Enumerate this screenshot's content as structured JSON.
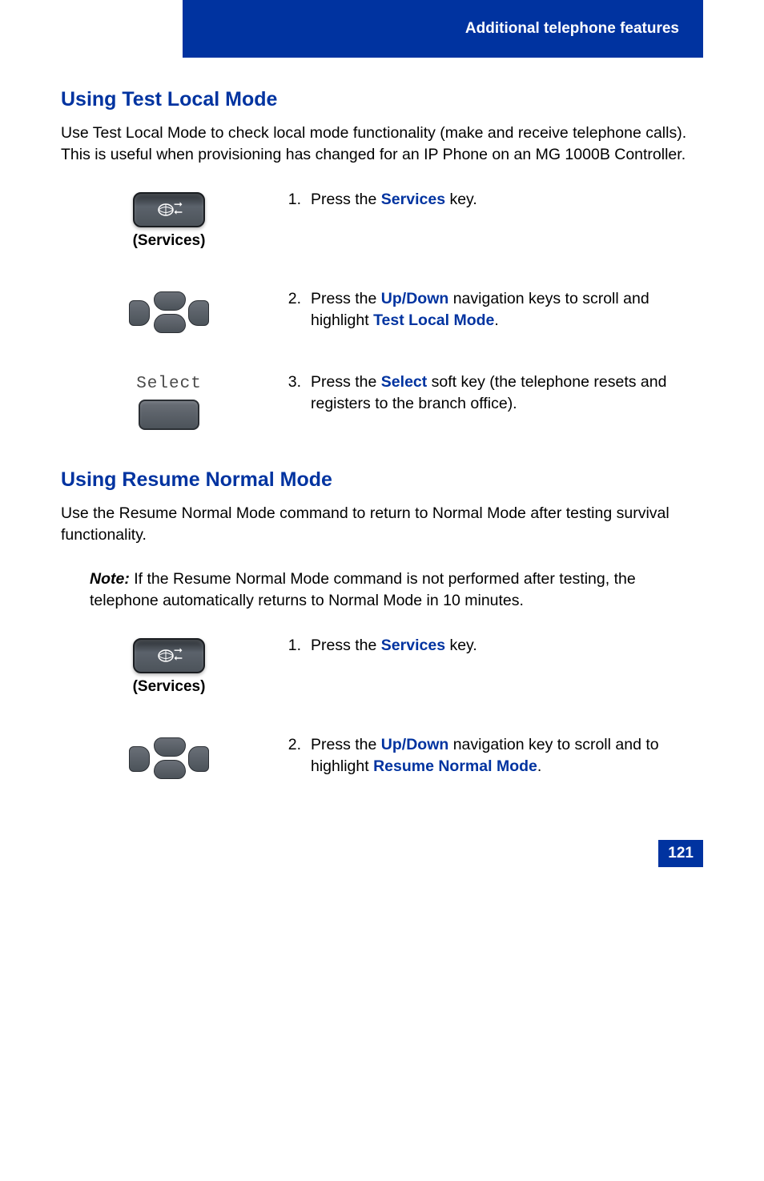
{
  "header": {
    "title": "Additional telephone features"
  },
  "section1": {
    "title": "Using Test Local Mode",
    "intro": "Use Test Local Mode to check local mode functionality (make and receive telephone calls). This is useful when provisioning has changed for an IP Phone on an MG 1000B Controller.",
    "services_label": "(Services)",
    "steps": {
      "s1": {
        "num": "1.",
        "pre": "Press the ",
        "kw": "Services",
        "post": " key."
      },
      "s2": {
        "num": "2.",
        "pre": "Press the ",
        "kw": "Up/Down",
        "mid": " navigation keys to scroll and highlight ",
        "kw2": "Test Local Mode",
        "post": "."
      },
      "s3": {
        "num": "3.",
        "pre": "Press the ",
        "kw": "Select",
        "post": " soft key (the telephone resets and registers to the branch office)."
      }
    },
    "select_screen_label": "Select"
  },
  "section2": {
    "title": "Using Resume Normal Mode",
    "intro": "Use the Resume Normal Mode command to return to Normal Mode after testing survival functionality.",
    "note_label": "Note:",
    "note_text": " If the Resume Normal Mode command is not performed after testing, the telephone automatically returns to Normal Mode in 10 minutes.",
    "services_label": "(Services)",
    "steps": {
      "s1": {
        "num": "1.",
        "pre": "Press the ",
        "kw": "Services",
        "post": " key."
      },
      "s2": {
        "num": "2.",
        "pre": "Press the ",
        "kw": "Up/Down",
        "mid": " navigation key to scroll and to highlight ",
        "kw2": "Resume Normal Mode",
        "post": "."
      }
    }
  },
  "page_number": "121"
}
